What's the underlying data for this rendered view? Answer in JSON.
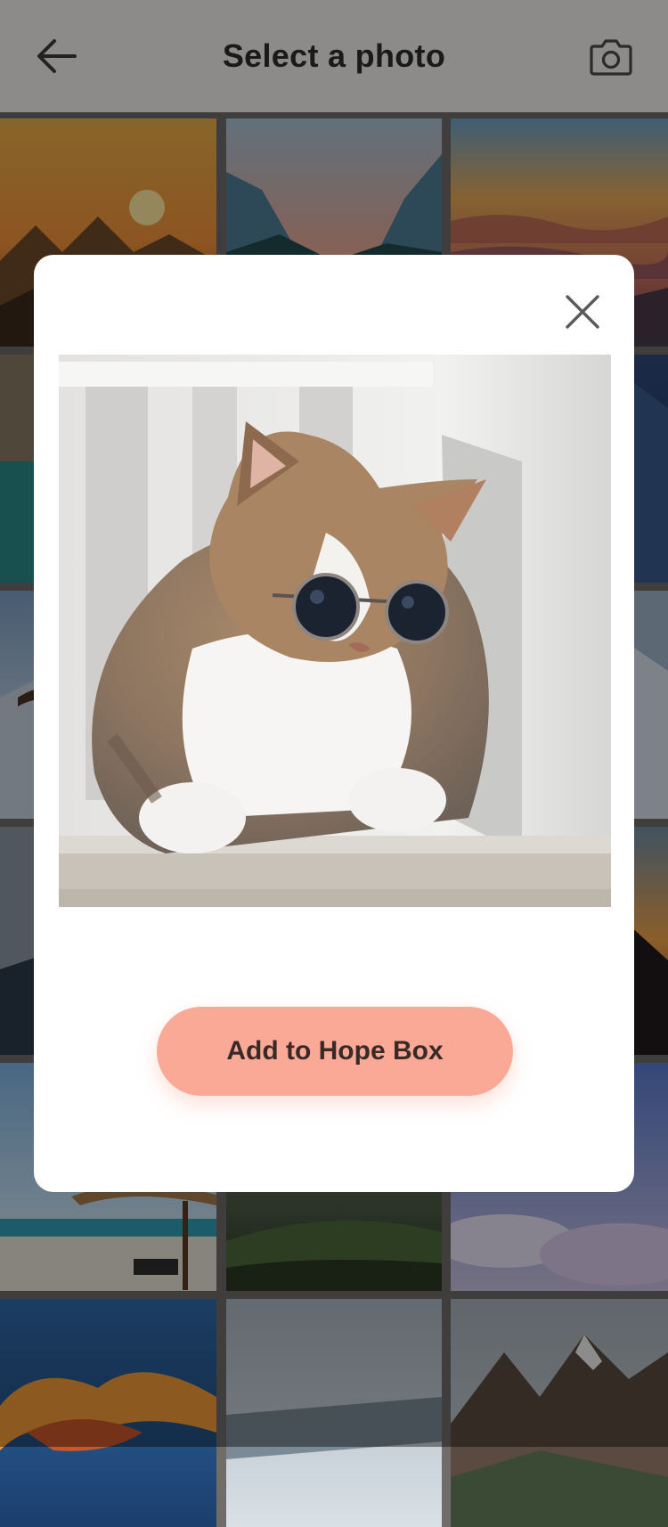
{
  "header": {
    "title": "Select a photo",
    "back_icon": "arrow-left-icon",
    "camera_icon": "camera-icon"
  },
  "grid": {
    "photos": [
      {
        "name": "sunset-mountains"
      },
      {
        "name": "valley-dusk"
      },
      {
        "name": "sunset-clouds-layers"
      },
      {
        "name": "lake-cliffs"
      },
      {
        "name": "lake-cliffs-middle"
      },
      {
        "name": "blue-mountains"
      },
      {
        "name": "eagle-over-mountains"
      },
      {
        "name": "soaring-eagle"
      },
      {
        "name": "misty-peaks"
      },
      {
        "name": "grey-coast"
      },
      {
        "name": "dark-hills"
      },
      {
        "name": "sunset-mountain-silhouette"
      },
      {
        "name": "beach-umbrella"
      },
      {
        "name": "green-hills-sunrays"
      },
      {
        "name": "sea-of-clouds"
      },
      {
        "name": "orange-sky-clouds"
      },
      {
        "name": "snowy-forest"
      },
      {
        "name": "mountain-river"
      }
    ]
  },
  "modal": {
    "close_icon": "close-icon",
    "preview_image": "cat-with-sunglasses",
    "add_button_label": "Add to Hope Box"
  },
  "colors": {
    "header_bg": "#f2efec",
    "accent": "#fba997",
    "button_text": "#3a2a27",
    "title_text": "#2e2e2e"
  }
}
